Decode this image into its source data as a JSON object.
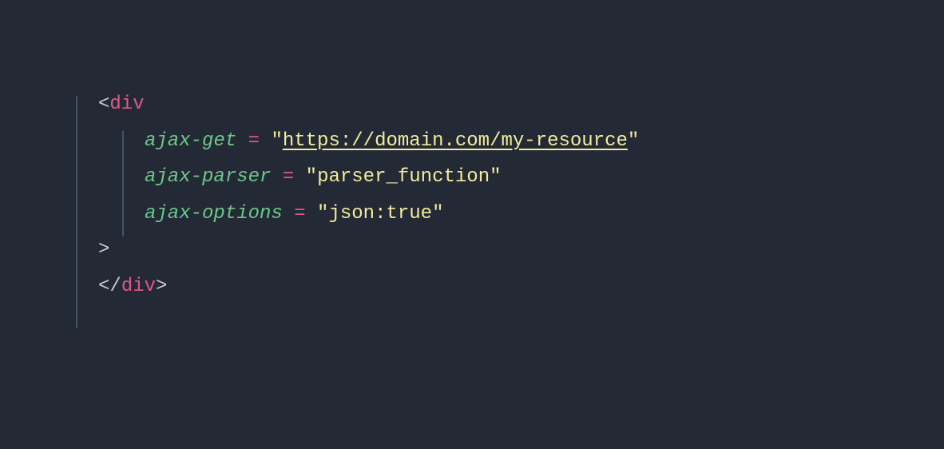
{
  "code": {
    "line1": {
      "bracket_open": "<",
      "tag": "div"
    },
    "line2": {
      "attr": "ajax-get",
      "equals": " = ",
      "quote1": "\"",
      "value": "https://domain.com/my-resource",
      "quote2": "\""
    },
    "line3": {
      "attr": "ajax-parser",
      "equals": " = ",
      "quote1": "\"",
      "value": "parser_function",
      "quote2": "\""
    },
    "line4": {
      "attr": "ajax-options",
      "equals": " = ",
      "quote1": "\"",
      "value": "json:true",
      "quote2": "\""
    },
    "line5": {
      "bracket_close": ">"
    },
    "line6": {
      "bracket_open": "</",
      "tag": "div",
      "bracket_close": ">"
    }
  }
}
